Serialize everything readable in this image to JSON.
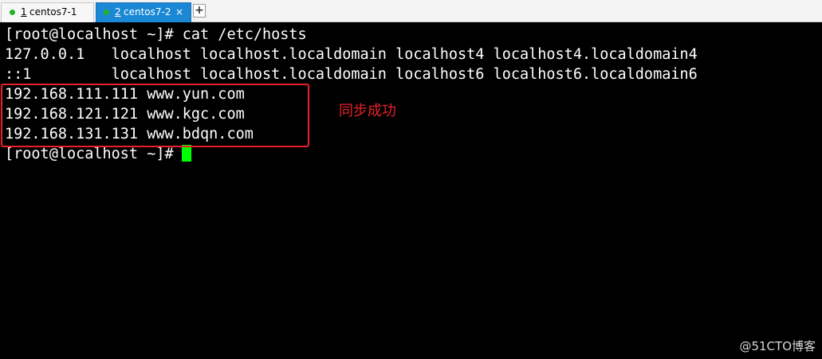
{
  "tabs": [
    {
      "number": "1",
      "label": "centos7-1",
      "active": false,
      "status_color": "#24b324"
    },
    {
      "number": "2",
      "label": "centos7-2",
      "active": true,
      "status_color": "#24b324",
      "close_glyph": "×"
    }
  ],
  "tab_add_glyph": "+",
  "terminal": {
    "lines": [
      "[root@localhost ~]# cat /etc/hosts",
      "127.0.0.1   localhost localhost.localdomain localhost4 localhost4.localdomain4",
      "::1         localhost localhost.localdomain localhost6 localhost6.localdomain6",
      "192.168.111.111 www.yun.com",
      "192.168.121.121 www.kgc.com",
      "192.168.131.131 www.bdqn.com"
    ],
    "prompt": "[root@localhost ~]#",
    "cursor_color": "#00ff00"
  },
  "annotation": {
    "text": "同步成功",
    "color": "#e8202a"
  },
  "watermark": "@51CTO博客"
}
